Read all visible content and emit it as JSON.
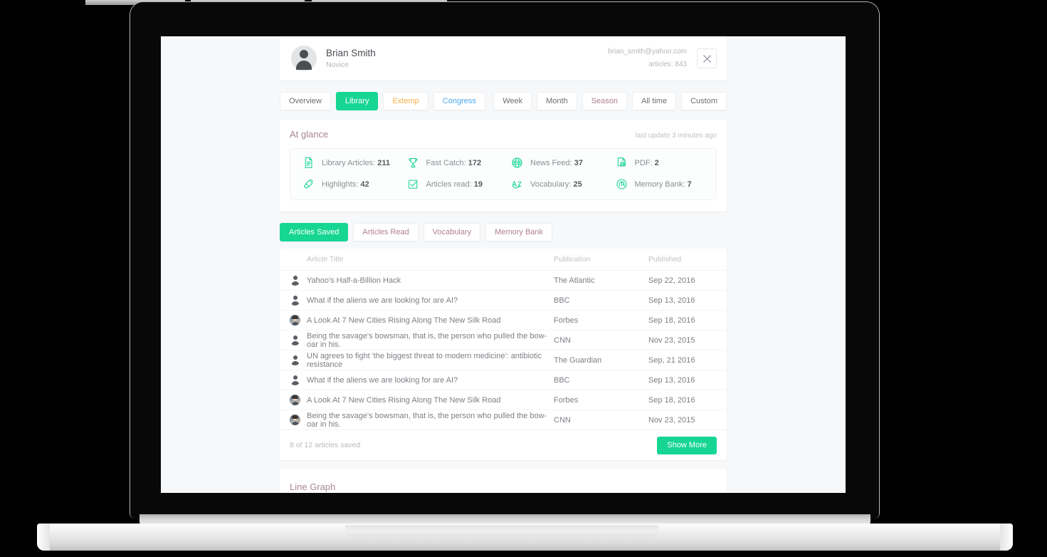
{
  "profile": {
    "name": "Brian Smith",
    "rank": "Novice",
    "email": "brian_smith@yahoo.com",
    "articles_count": "articles: 843",
    "avatar_icon": "person-avatar-icon",
    "close_icon": "close-icon"
  },
  "section_tabs": [
    {
      "label": "Overview",
      "state": "default",
      "style": "dark"
    },
    {
      "label": "Library",
      "state": "active",
      "style": "active"
    },
    {
      "label": "Extemp",
      "state": "default",
      "style": "amber"
    },
    {
      "label": "Congress",
      "state": "default",
      "style": "blue"
    }
  ],
  "range_tabs": [
    {
      "label": "Week",
      "style": "dark"
    },
    {
      "label": "Month",
      "style": "dark"
    },
    {
      "label": "Season",
      "style": "mauve"
    },
    {
      "label": "All time",
      "style": "dark"
    },
    {
      "label": "Custom",
      "style": "dark"
    }
  ],
  "glance": {
    "title": "At glance",
    "last_update": "last update 3 minutes ago",
    "stats": [
      {
        "icon": "document-icon",
        "label": "Library Articles:",
        "value": "211"
      },
      {
        "icon": "trophy-icon",
        "label": "Fast Catch:",
        "value": "172"
      },
      {
        "icon": "globe-icon",
        "label": "News Feed:",
        "value": "37"
      },
      {
        "icon": "pdf-file-icon",
        "label": "PDF:",
        "value": "2"
      },
      {
        "icon": "highlighter-icon",
        "label": "Highlights:",
        "value": "42"
      },
      {
        "icon": "checkbox-icon",
        "label": "Articles read:",
        "value": "19"
      },
      {
        "icon": "vocabulary-az-icon",
        "label": "Vocabulary:",
        "value": "25"
      },
      {
        "icon": "brain-icon",
        "label": "Memory Bank:",
        "value": "7"
      }
    ]
  },
  "content_tabs": [
    {
      "label": "Articles Saved",
      "style": "active"
    },
    {
      "label": "Articles Read",
      "style": "mauve"
    },
    {
      "label": "Vocabulary",
      "style": "mauve"
    },
    {
      "label": "Memory Bank",
      "style": "mauve"
    }
  ],
  "table": {
    "columns": [
      "Article Title",
      "Publication",
      "Published"
    ],
    "rows": [
      {
        "avatar": "default-avatar",
        "title": "Yahoo's Half-a-Billion Hack",
        "publication": "The Atlantic",
        "published": "Sep 22, 2016"
      },
      {
        "avatar": "default-avatar",
        "title": "What if the aliens we are looking for are AI?",
        "publication": "BBC",
        "published": "Sep 13, 2016"
      },
      {
        "avatar": "photo-avatar",
        "title": "A Look At 7 New Cities Rising Along The New Silk Road",
        "publication": "Forbes",
        "published": "Sep 18, 2016"
      },
      {
        "avatar": "default-avatar",
        "title": "Being the savage's bowsman, that is, the person who pulled the bow-oar in his.",
        "publication": "CNN",
        "published": "Nov 23, 2015"
      },
      {
        "avatar": "default-avatar",
        "title": "UN agrees to fight 'the biggest threat to modern medicine': antibiotic resistance",
        "publication": "The Guardian",
        "published": "Sep, 21 2016"
      },
      {
        "avatar": "default-avatar",
        "title": "What if the aliens we are looking for are AI?",
        "publication": "BBC",
        "published": "Sep 13, 2016"
      },
      {
        "avatar": "photo-avatar",
        "title": "A Look At 7 New Cities Rising Along The New Silk Road",
        "publication": "Forbes",
        "published": "Sep 18, 2016"
      },
      {
        "avatar": "photo-avatar",
        "title": "Being the savage's bowsman, that is, the person who pulled the bow-oar in his.",
        "publication": "CNN",
        "published": "Nov 23, 2015"
      }
    ],
    "footer_note": "8 of 12 articles saved",
    "show_more_label": "Show More"
  },
  "graph": {
    "title": "Line Graph"
  },
  "colors": {
    "accent_green": "#17d694",
    "amber": "#f7b14b",
    "blue": "#4aa8f0",
    "mauve": "#a98794",
    "page_bg": "#f7f8fa"
  }
}
